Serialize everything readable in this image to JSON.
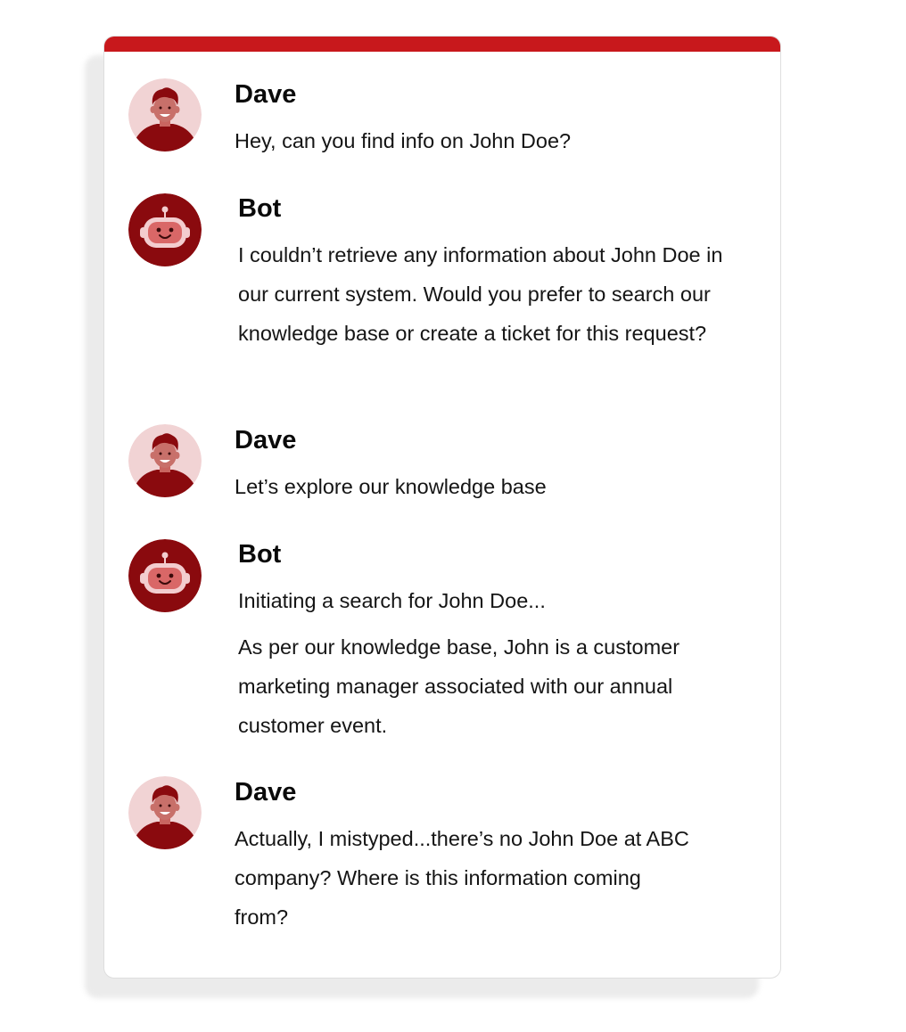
{
  "colors": {
    "accent": "#c8181c",
    "bot_avatar": "#8a0a0e",
    "user_avatar_bg": "#f1d3d4"
  },
  "conversation": [
    {
      "sender": "Dave",
      "avatar": "person-avatar-icon",
      "paragraphs": [
        "Hey, can you find info on John Doe?"
      ]
    },
    {
      "sender": "Bot",
      "avatar": "robot-avatar-icon",
      "paragraphs": [
        "I couldn’t retrieve any information about John Doe in our current system. Would you prefer to search our knowledge base or create a ticket for this request?"
      ]
    },
    {
      "sender": "Dave",
      "avatar": "person-avatar-icon",
      "paragraphs": [
        "Let’s explore our knowledge base"
      ]
    },
    {
      "sender": "Bot",
      "avatar": "robot-avatar-icon",
      "paragraphs": [
        "Initiating a search for John Doe...",
        "As per our knowledge base, John is a customer marketing manager associated with our annual customer event."
      ]
    },
    {
      "sender": "Dave",
      "avatar": "person-avatar-icon",
      "paragraphs": [
        "Actually, I mistyped...there’s no John Doe at ABC company? Where is this information coming from?"
      ]
    }
  ]
}
